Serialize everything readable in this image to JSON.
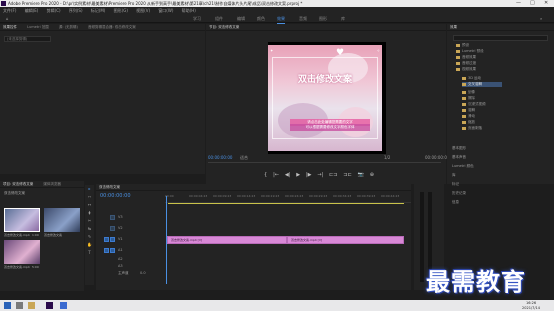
{
  "window": {
    "title": "Adobe Premiere Pro 2020 - D:\\pr\\实例素材\\最美素材\\Premiere Pro 2020 从新手到高手\\最美素材\\第21章\\ch21\\制作自媒体片头片尾\\成品\\双击修改文案.prproj *",
    "minimize_glyph": "—",
    "maximize_glyph": "□",
    "close_glyph": "✕"
  },
  "menu": [
    "文件(F)",
    "编辑(E)",
    "剪辑(C)",
    "序列(S)",
    "标记(M)",
    "图形(G)",
    "视图(V)",
    "窗口(W)",
    "帮助(H)"
  ],
  "workspaces": [
    "学习",
    "组件",
    "编辑",
    "颜色",
    "效果",
    "音频",
    "图形",
    "库"
  ],
  "active_workspace": "效果",
  "source_panel": {
    "tabs": [
      "效果控件",
      "Lumetri 范围",
      "源: (无剪辑)",
      "音频剪辑混合器: 双击修改文案"
    ],
    "field": "(未选择剪辑)"
  },
  "program_panel": {
    "tab": "节目: 双击修改文案",
    "caption_main": "双击修改文案",
    "caption_sub": "请点击此处编辑您需要的文字",
    "caption_sub2": "可以根据需要修改文字颜色字体",
    "timecode": "00:00:00:00",
    "fit": "适合",
    "resolution": "1/2",
    "end_timecode": "00:00:00:00",
    "transport": [
      "{",
      "|←",
      "◀|",
      "▶",
      "|▶",
      "→|",
      "⊏⊐",
      "⊐⊏",
      "📷",
      "⊕"
    ]
  },
  "effects_panel": {
    "tab": "效果",
    "search_placeholder": "",
    "items": [
      {
        "label": "预设",
        "selected": false
      },
      {
        "label": "Lumetri 预设",
        "selected": false
      },
      {
        "label": "音频效果",
        "selected": false
      },
      {
        "label": "音频过渡",
        "selected": false
      },
      {
        "label": "视频效果",
        "selected": false
      },
      {
        "label": "3D 运动",
        "selected": false
      },
      {
        "label": "交叉溶解",
        "selected": true
      },
      {
        "label": "划像",
        "selected": false
      },
      {
        "label": "擦除",
        "selected": false
      },
      {
        "label": "沉浸式视频",
        "selected": false
      },
      {
        "label": "溶解",
        "selected": false
      },
      {
        "label": "滑动",
        "selected": false
      },
      {
        "label": "缩放",
        "selected": false
      },
      {
        "label": "页面剥落",
        "selected": false
      }
    ],
    "side_labels": [
      "基本图形",
      "基本声音",
      "Lumetri 颜色",
      "库",
      "标记",
      "历史记录",
      "信息"
    ]
  },
  "project_panel": {
    "tabs": [
      "项目: 双击修改文案",
      "媒体浏览器"
    ],
    "filter": "双击修改文案",
    "items": [
      {
        "label": "双击修改文案.mp4",
        "duration": "1:00"
      },
      {
        "label": "双击修改文案",
        "duration": ""
      },
      {
        "label": "双击修改文案.mp4",
        "duration": "5:00"
      }
    ]
  },
  "tools": [
    "▸",
    "⇿",
    "↔",
    "⧫",
    "✂",
    "↹",
    "✎",
    "✋",
    "T"
  ],
  "timeline": {
    "tab": "双击修改文案",
    "timecode": "00:00:00:00",
    "ruler": [
      "00:00",
      "00:00:04:23",
      "00:00:09:23",
      "00:00:14:23",
      "00:00:19:23",
      "00:00:24:23",
      "00:00:29:23",
      "00:00:34:23",
      "00:00:39:23",
      "00:00:44:23",
      "00:00:49:23"
    ],
    "tracks": [
      "V3",
      "V2",
      "V1",
      "A1",
      "A2",
      "A3",
      "主声道"
    ],
    "master_value": "0.0",
    "clips": [
      {
        "label": "双击修改文案.mp4 [V]"
      },
      {
        "label": "双击修改文案.mp4 [V]"
      }
    ]
  },
  "watermark": "最需教育",
  "taskbar": {
    "time": "16:26",
    "date": "2021/7/14"
  },
  "colors": {
    "accent": "#4a90e2",
    "clip": "#d888d6",
    "work_area": "#c9c24a"
  }
}
